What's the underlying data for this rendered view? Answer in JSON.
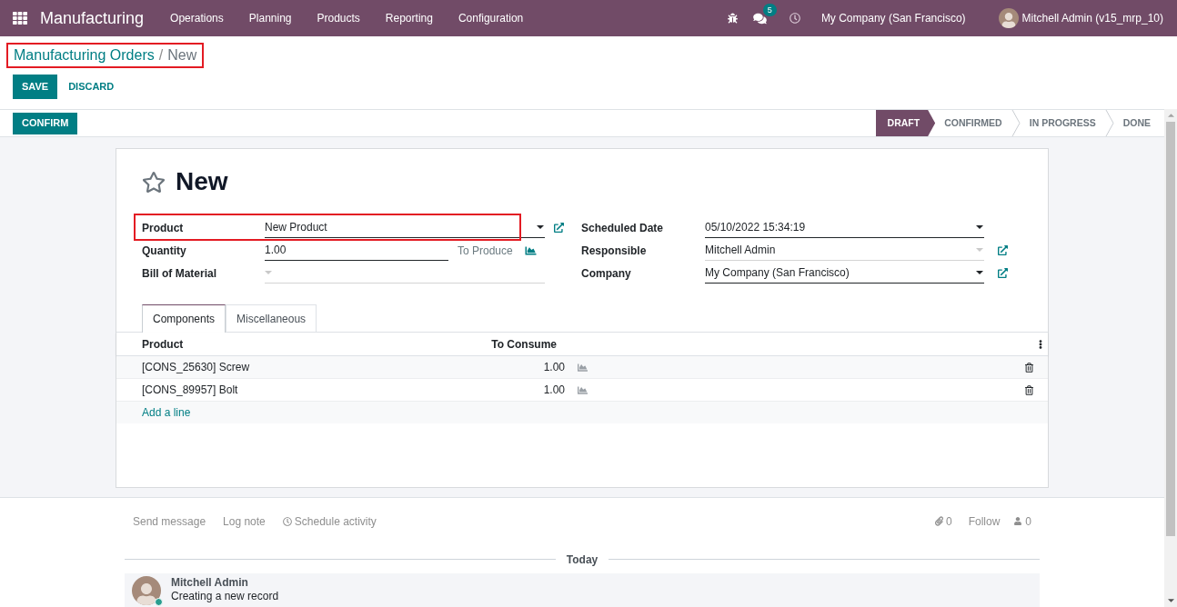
{
  "navbar": {
    "app_name": "Manufacturing",
    "menus": [
      "Operations",
      "Planning",
      "Products",
      "Reporting",
      "Configuration"
    ],
    "unread_messages": "5",
    "company": "My Company (San Francisco)",
    "user": "Mitchell Admin (v15_mrp_10)"
  },
  "breadcrumb": {
    "parent": "Manufacturing Orders",
    "separator": "/",
    "current": "New",
    "highlighted": true
  },
  "buttons": [
    {
      "label": "SAVE",
      "kind": "primary"
    },
    {
      "label": "DISCARD",
      "kind": "link"
    }
  ],
  "status_bar": {
    "actions": [
      {
        "label": "CONFIRM",
        "kind": "primary"
      }
    ],
    "stages": [
      {
        "label": "DRAFT",
        "selected": true
      },
      {
        "label": "CONFIRMED",
        "selected": false
      },
      {
        "label": "IN PROGRESS",
        "selected": false
      },
      {
        "label": "DONE",
        "selected": false
      }
    ]
  },
  "form": {
    "title": "New",
    "starred": false,
    "left_fields": [
      {
        "label": "Product",
        "value": "New Product",
        "dropdown": true,
        "required": true,
        "open_link": true,
        "highlighted": true
      },
      {
        "label": "Quantity",
        "value": "1.00",
        "dropdown": false,
        "required": true,
        "unit_label": "To Produce",
        "open_link": false,
        "highlighted": false
      },
      {
        "label": "Bill of Material",
        "dropdown": true,
        "required": false,
        "open_link": false,
        "highlighted": false
      }
    ],
    "right_fields": [
      {
        "label": "Scheduled Date",
        "value": "05/10/2022 15:34:19",
        "dropdown": true,
        "required": true,
        "open_link": false,
        "highlighted": false
      },
      {
        "label": "Responsible",
        "value": "Mitchell Admin",
        "dropdown": true,
        "required": false,
        "open_link": true,
        "highlighted": false
      },
      {
        "label": "Company",
        "value": "My Company (San Francisco)",
        "dropdown": true,
        "required": true,
        "open_link": true,
        "highlighted": false
      }
    ],
    "tabs": [
      {
        "label": "Components",
        "selected": true
      },
      {
        "label": "Miscellaneous",
        "selected": false
      }
    ],
    "components": {
      "columns": [
        "Product",
        "To Consume"
      ],
      "rows": [
        {
          "product": "[CONS_25630] Screw",
          "to_consume": "1.00"
        },
        {
          "product": "[CONS_89957] Bolt",
          "to_consume": "1.00"
        }
      ],
      "add_line": "Add a line"
    }
  },
  "chatter": {
    "actions": [
      {
        "label": "Send message",
        "kind": "plain"
      },
      {
        "label": "Log note",
        "kind": "plain"
      },
      {
        "label": "Schedule activity",
        "kind": "activity"
      }
    ],
    "attachments": "0",
    "follow": "Follow",
    "followers": "0",
    "date_divider": "Today",
    "messages": [
      {
        "author": "Mitchell Admin",
        "body": "Creating a new record"
      }
    ]
  }
}
